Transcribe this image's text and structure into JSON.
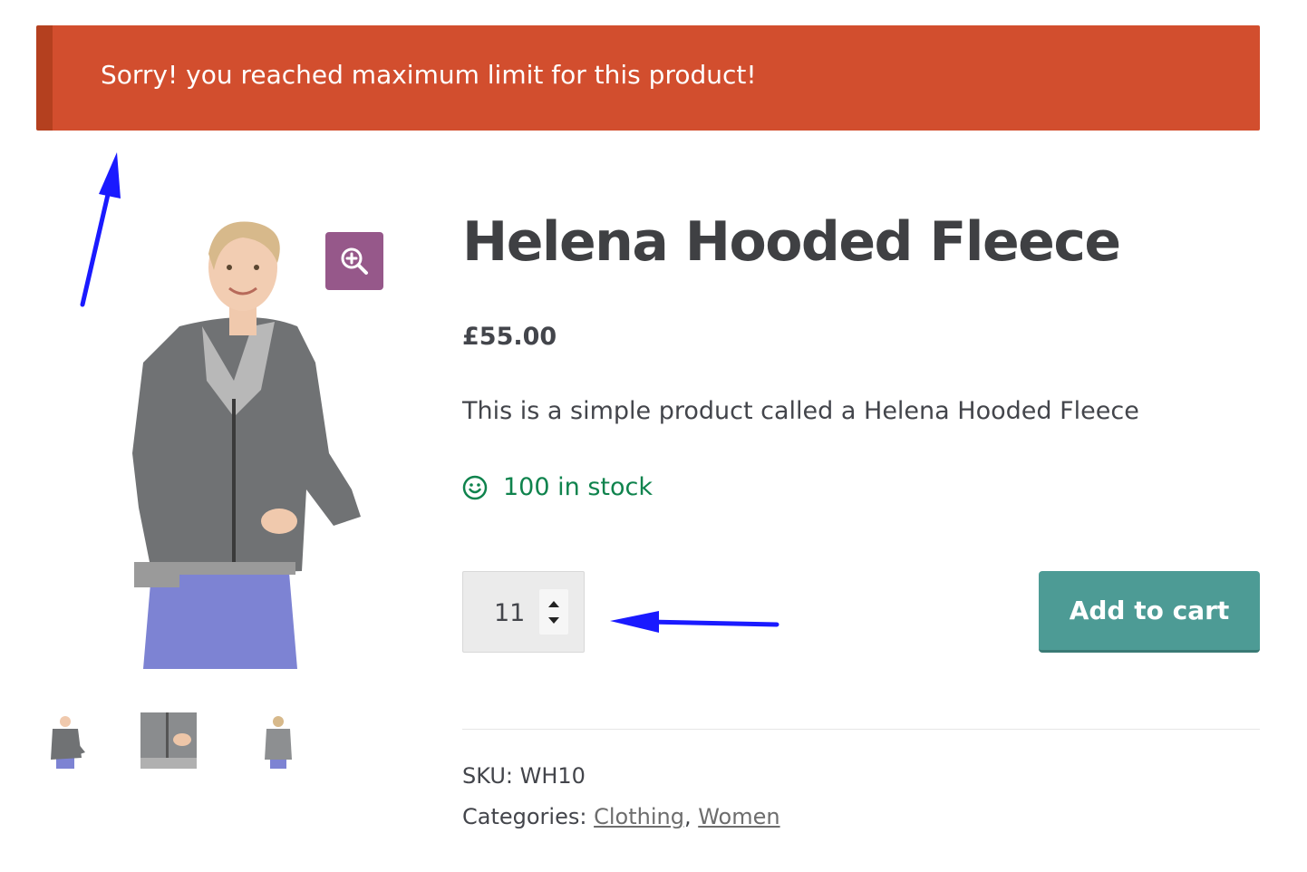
{
  "notice": {
    "message": "Sorry! you reached maximum limit for this product!"
  },
  "product": {
    "title": "Helena Hooded Fleece",
    "price": "£55.00",
    "description": "This is a simple product called a Helena Hooded Fleece",
    "stock": "100 in stock",
    "quantity": "11",
    "add_to_cart_label": "Add to cart",
    "sku_label": "SKU:",
    "sku_value": "WH10",
    "categories_label": "Categories:",
    "categories": [
      "Clothing",
      "Women"
    ],
    "category_separator": ","
  },
  "gallery": {
    "main_icon": "model-hoodie-front-image",
    "zoom_icon": "zoom-in-icon",
    "thumbnails": [
      "thumb-front",
      "thumb-pocket",
      "thumb-back"
    ]
  },
  "colors": {
    "notice_bg": "#d24e2e",
    "zoom_bg": "#96588a",
    "button_bg": "#4d9b95",
    "stock_green": "#0f834d",
    "annotation_arrow": "#1a1aff"
  }
}
